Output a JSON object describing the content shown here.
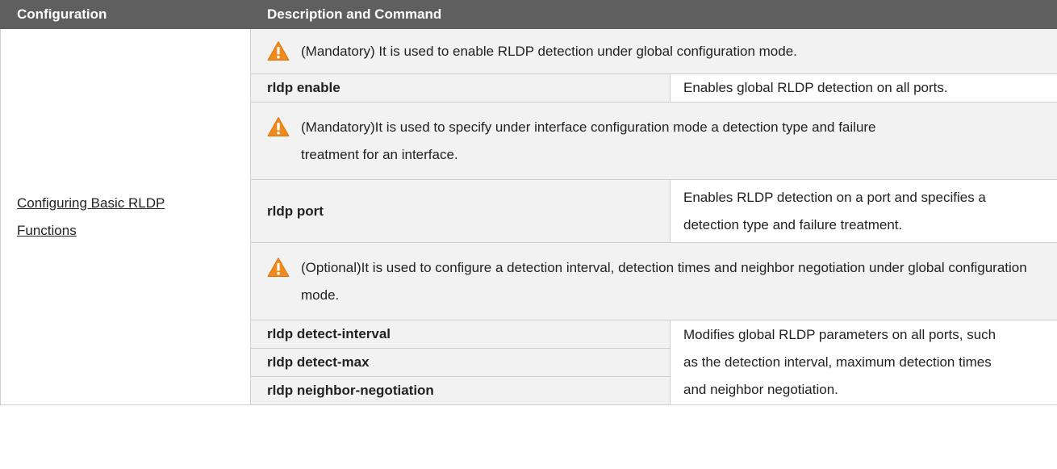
{
  "header": {
    "col1": "Configuration",
    "col2": "Description and Command"
  },
  "configuration": {
    "label": "Configuring Basic RLDP Functions"
  },
  "sections": {
    "s1": {
      "note": "(Mandatory) It is used to enable RLDP detection under global configuration mode.",
      "cmd": "rldp enable",
      "desc": "Enables global RLDP detection on all ports."
    },
    "s2": {
      "note": "(Mandatory)It is used to specify under interface configuration mode a detection type and failure treatment for an interface.",
      "cmd": "rldp port",
      "desc": "Enables RLDP detection on a port and specifies a detection type and failure treatment."
    },
    "s3": {
      "note": "(Optional)It is used to configure a detection interval, detection times and neighbor negotiation under global configuration mode.",
      "cmds": [
        "rldp detect-interval",
        "rldp detect-max",
        "rldp neighbor-negotiation"
      ],
      "desc": "Modifies global RLDP parameters on all ports, such as the detection interval, maximum detection times and neighbor negotiation."
    }
  },
  "icons": {
    "warning": "warning-triangle-icon"
  },
  "colors": {
    "header_bg": "#5f5f5f",
    "shaded_bg": "#f2f2f2",
    "warning": "#f08a1c"
  }
}
